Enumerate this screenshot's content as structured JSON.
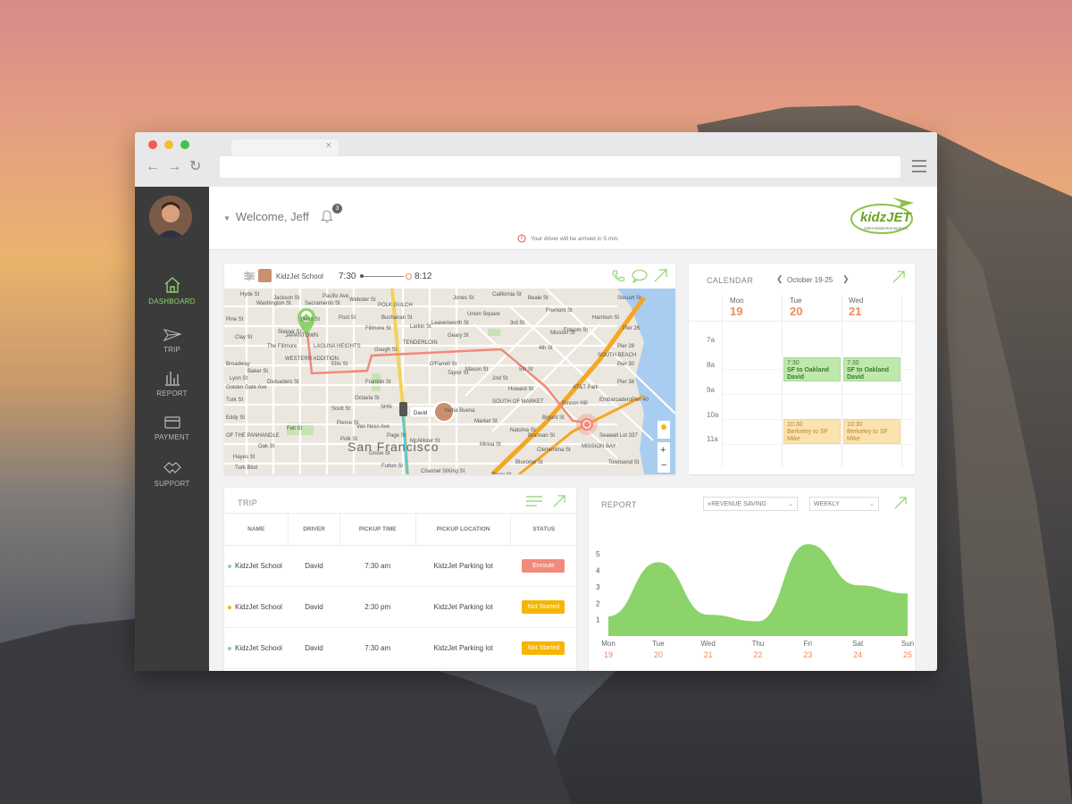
{
  "header": {
    "welcome": "Welcome, Jeff",
    "notification_count": "3",
    "notice": "Your driver will be arrived in 5 min.",
    "logo_text": "kidzJET",
    "logo_tagline": "safe•reliable•transparent"
  },
  "sidebar": {
    "items": [
      {
        "label": "DASHBOARD",
        "icon": "home-icon"
      },
      {
        "label": "TRIP",
        "icon": "paper-plane-icon"
      },
      {
        "label": "REPORT",
        "icon": "bar-chart-icon"
      },
      {
        "label": "PAYMENT",
        "icon": "credit-card-icon"
      },
      {
        "label": "SUPPORT",
        "icon": "handshake-icon"
      }
    ]
  },
  "map_panel": {
    "school": "KidzJet School",
    "start_time": "7:30",
    "end_time": "8:12",
    "driver_label": "David",
    "city_label": "San Francisco",
    "streets": [
      "Jackson St",
      "Sacramento St",
      "Bush St",
      "Pine St",
      "The Fillmore",
      "JAPANTOWN",
      "LAGUNA HEIGHTS",
      "WESTERN ADDITION",
      "Golden Gate Ave",
      "Turk St",
      "Eddy St",
      "Fell St",
      "Oak St",
      "POLK GULCH",
      "Union Square",
      "TENDERLOIN",
      "Mission St",
      "Howard St",
      "SOUTH OF MARKET",
      "SOUTH BEACH",
      "MISSION BAY",
      "Folsom St",
      "Harrison St",
      "Bryant St",
      "Brannan St",
      "California St",
      "Geary St",
      "O'Farrell St",
      "Franklin St",
      "Gough St",
      "Octavia St",
      "Divisadero St",
      "Steiner St",
      "Fillmore St",
      "Buchanan St",
      "Webster St",
      "Larkin St",
      "Leavenworth St",
      "Jones St",
      "Taylor St",
      "Mason St",
      "Hyde St",
      "2nd St",
      "3rd St",
      "4th St",
      "5th St",
      "AT&T Park",
      "SHN",
      "OF THE PANHANDLE",
      "Pacific Ave",
      "Hayes St",
      "Post St",
      "Ellis St",
      "Market St",
      "Townsend St",
      "Steuart St",
      "Embarcadero",
      "Beale St",
      "Fremont St",
      "Natoma St",
      "Clementina St",
      "Minna St",
      "Bluxome St",
      "King St",
      "Berry St",
      "Channel St",
      "Seawall Lot 337",
      "Pier 40",
      "Pier 38",
      "Pier 30",
      "Pier 28",
      "Pier 26",
      "Rincon Hill",
      "Yerba Buena",
      "Van Ness Ave",
      "Polk St",
      "Broadway",
      "Washington St",
      "Clay St",
      "Turk Blvd",
      "Page St",
      "Grove St",
      "Fulton St",
      "McAllister St",
      "Baker St",
      "Lyon St",
      "Scott St",
      "Pierce St"
    ]
  },
  "calendar": {
    "title": "CALENDAR",
    "range": "October 19-25",
    "days": [
      {
        "day": "Mon",
        "num": "19"
      },
      {
        "day": "Tue",
        "num": "20"
      },
      {
        "day": "Wed",
        "num": "21"
      }
    ],
    "times": [
      "7a",
      "8a",
      "9a",
      "10a",
      "11a"
    ],
    "events": [
      {
        "time": "7:30",
        "title": "SF to Oakland",
        "who": "David",
        "color": "green"
      },
      {
        "time": "7:30",
        "title": "SF to Oakland",
        "who": "David",
        "color": "green"
      },
      {
        "time": "10:30",
        "title": "Berkeley to SF",
        "who": "Mike",
        "color": "yellow"
      },
      {
        "time": "10:30",
        "title": "Berkeley to SF",
        "who": "Mike",
        "color": "yellow"
      }
    ]
  },
  "trip": {
    "title": "TRIP",
    "columns": [
      "NAME",
      "DRIVER",
      "PICKUP TIME",
      "PICKUP LOCATION",
      "STATUS"
    ],
    "rows": [
      {
        "name": "KidzJet School",
        "driver": "David",
        "time": "7:30 am",
        "location": "KidzJet Parking lot",
        "status": "Enroute",
        "status_color": "#f08a7a",
        "dot_color": "#8bd3b0"
      },
      {
        "name": "KidzJet School",
        "driver": "David",
        "time": "2:30 pm",
        "location": "KidzJet Parking lot",
        "status": "Not Started",
        "status_color": "#f7b500",
        "dot_color": "#f7b500"
      },
      {
        "name": "KidzJet School",
        "driver": "David",
        "time": "7:30 am",
        "location": "KidzJet Parking lot",
        "status": "Not Started",
        "status_color": "#f7b500",
        "dot_color": "#8bd3b0"
      }
    ]
  },
  "report": {
    "title": "REPORT",
    "metric_select": "REVENUE SAVING",
    "period_select": "WEEKLY"
  },
  "chart_data": {
    "type": "area",
    "categories": [
      "Mon",
      "Tue",
      "Wed",
      "Thu",
      "Fri",
      "Sat",
      "Sun"
    ],
    "dates": [
      "19",
      "20",
      "21",
      "22",
      "23",
      "24",
      "25"
    ],
    "values": [
      1.2,
      4.5,
      1.3,
      0.9,
      5.6,
      3.1,
      2.6
    ],
    "ylim": [
      0,
      5.5
    ],
    "yticks": [
      "1",
      "2",
      "3",
      "4",
      "5"
    ],
    "color": "#8bd36a"
  },
  "colors": {
    "accent": "#8bd36a",
    "orange": "#f08a5d",
    "sidebar": "#3b3b3b"
  }
}
